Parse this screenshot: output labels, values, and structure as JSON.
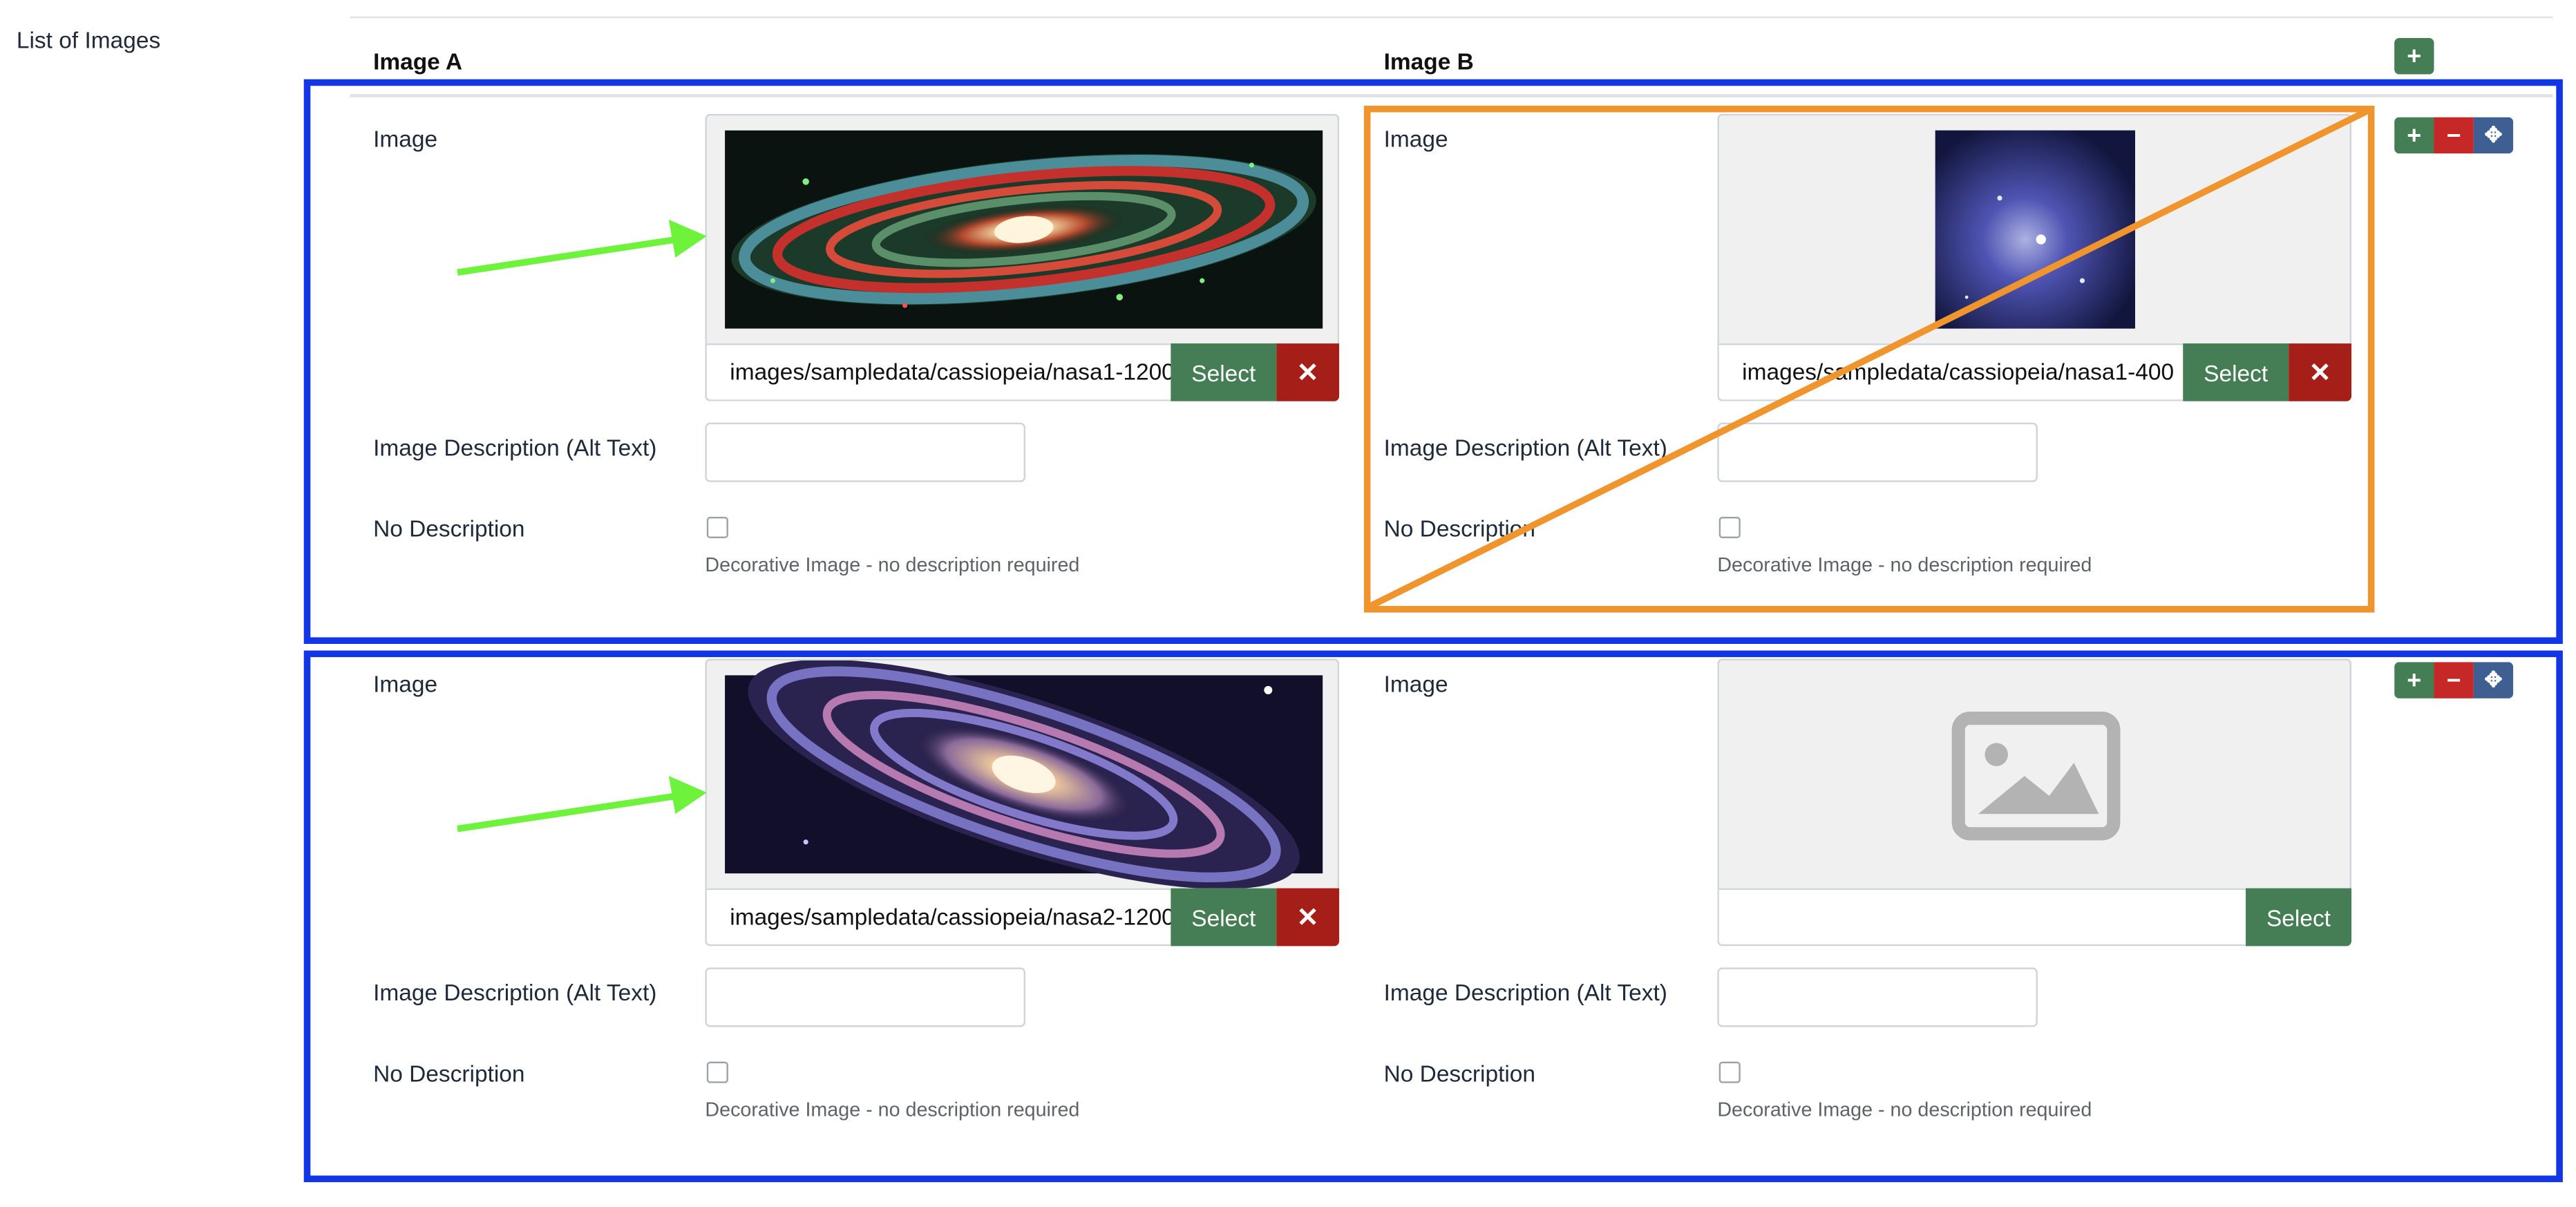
{
  "section": {
    "label": "List of Images"
  },
  "columns": {
    "a": "Image A",
    "b": "Image B"
  },
  "controls": {
    "add_icon": "plus-icon",
    "remove_icon": "minus-icon",
    "move_icon": "move-icon",
    "clear_icon": "close-icon"
  },
  "field_labels": {
    "image": "Image",
    "alt": "Image Description (Alt Text)",
    "no_desc": "No Description",
    "hint": "Decorative Image - no description required",
    "select": "Select"
  },
  "rows": [
    {
      "a": {
        "path": "images/sampledata/cassiopeia/nasa1-1200",
        "image": "andromeda-galaxy-infrared",
        "alt": "",
        "no_desc": false
      },
      "b": {
        "path": "images/sampledata/cassiopeia/nasa1-400",
        "image": "blue-nebula-square",
        "alt": "",
        "no_desc": false
      }
    },
    {
      "a": {
        "path": "images/sampledata/cassiopeia/nasa2-1200",
        "image": "spiral-galaxy-m81",
        "alt": "",
        "no_desc": false
      },
      "b": {
        "path": "",
        "image": "placeholder-image-icon",
        "alt": "",
        "no_desc": false
      }
    }
  ],
  "colors": {
    "annotation_blue": "#1236e6",
    "annotation_orange": "#f0952e",
    "annotation_green": "#6ef23c",
    "btn_green": "#457d54",
    "btn_red": "#c52827",
    "btn_blue": "#3f5e91"
  }
}
